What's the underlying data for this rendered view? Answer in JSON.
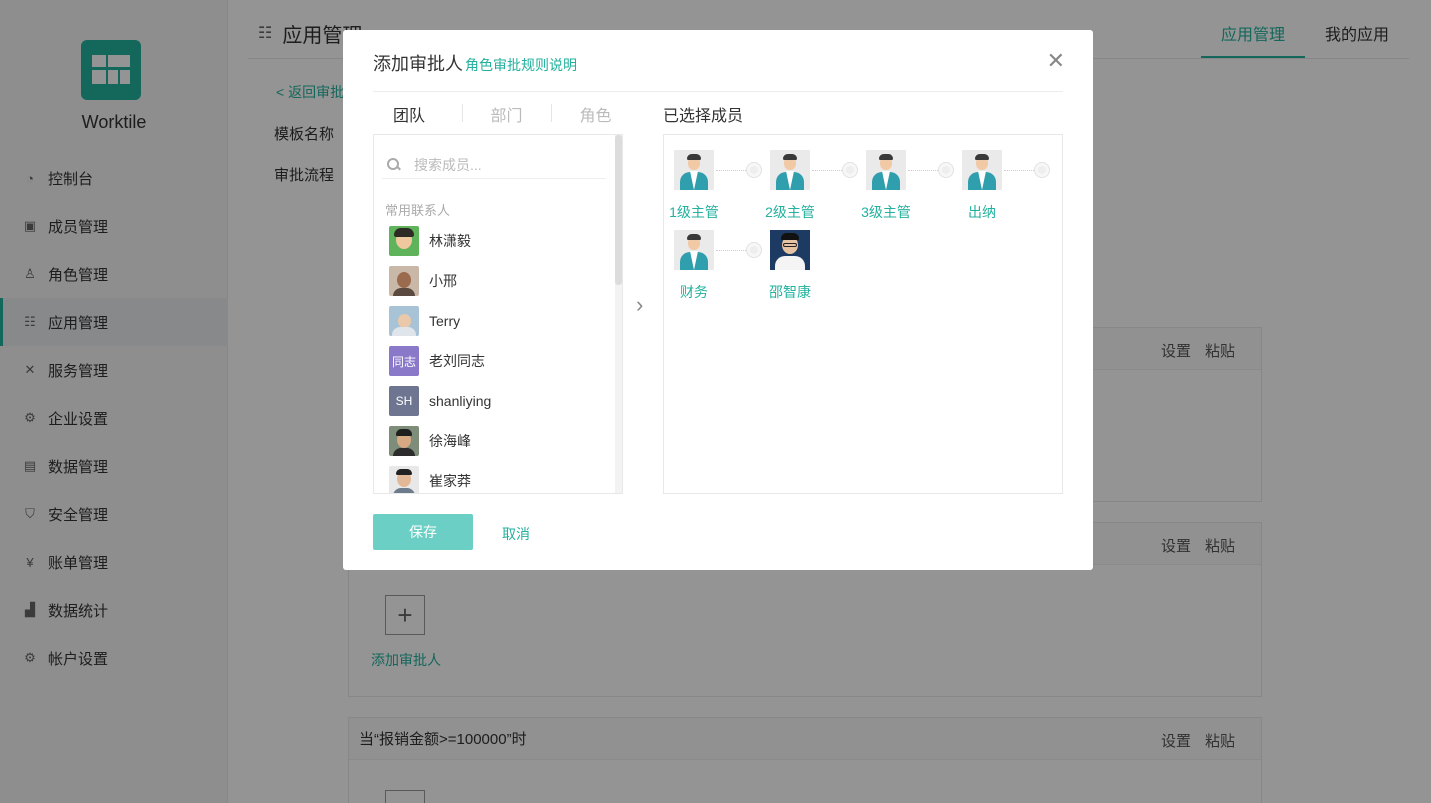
{
  "sidebar": {
    "brand": "Worktile",
    "items": [
      {
        "label": "控制台",
        "icon": "dashboard-icon"
      },
      {
        "label": "成员管理",
        "icon": "member-icon"
      },
      {
        "label": "角色管理",
        "icon": "role-icon"
      },
      {
        "label": "应用管理",
        "icon": "apps-icon",
        "active": true
      },
      {
        "label": "服务管理",
        "icon": "service-icon"
      },
      {
        "label": "企业设置",
        "icon": "gear-icon"
      },
      {
        "label": "数据管理",
        "icon": "data-icon"
      },
      {
        "label": "安全管理",
        "icon": "shield-icon"
      },
      {
        "label": "账单管理",
        "icon": "bill-icon"
      },
      {
        "label": "数据统计",
        "icon": "chart-icon"
      },
      {
        "label": "帐户设置",
        "icon": "account-gear-icon"
      }
    ]
  },
  "page": {
    "title": "应用管理",
    "tabs": [
      "应用管理",
      "我的应用"
    ],
    "back_link": "< 返回审批",
    "field_template_name": "模板名称",
    "field_flow": "审批流程",
    "card_actions": {
      "settings": "设置",
      "paste": "粘贴"
    },
    "add_approver": "添加审批人",
    "condition_text": "当“报销金额>=100000”时"
  },
  "modal": {
    "title": "添加审批人",
    "rule_link": "角色审批规则说明",
    "tabs": [
      "团队",
      "部门",
      "角色"
    ],
    "search_placeholder": "搜索成员...",
    "group_label": "常用联系人",
    "contacts": [
      {
        "name": "林潇毅"
      },
      {
        "name": "小邢"
      },
      {
        "name": "Terry"
      },
      {
        "name": "老刘同志",
        "avatar_text": "同志",
        "avatar_color": "#8a78c9"
      },
      {
        "name": "shanliying",
        "avatar_text": "SH",
        "avatar_color": "#6e7591"
      },
      {
        "name": "徐海峰"
      },
      {
        "name": "崔家莽"
      }
    ],
    "selected_title": "已选择成员",
    "selected": [
      {
        "label": "1级主管"
      },
      {
        "label": "2级主管"
      },
      {
        "label": "3级主管"
      },
      {
        "label": "出纳"
      },
      {
        "label": "财务"
      },
      {
        "label": "邵智康"
      }
    ],
    "save": "保存",
    "cancel": "取消"
  },
  "colors": {
    "accent": "#22b19e",
    "save_button": "#6ccfc5",
    "overlay": "rgba(0,0,0,0.42)"
  }
}
